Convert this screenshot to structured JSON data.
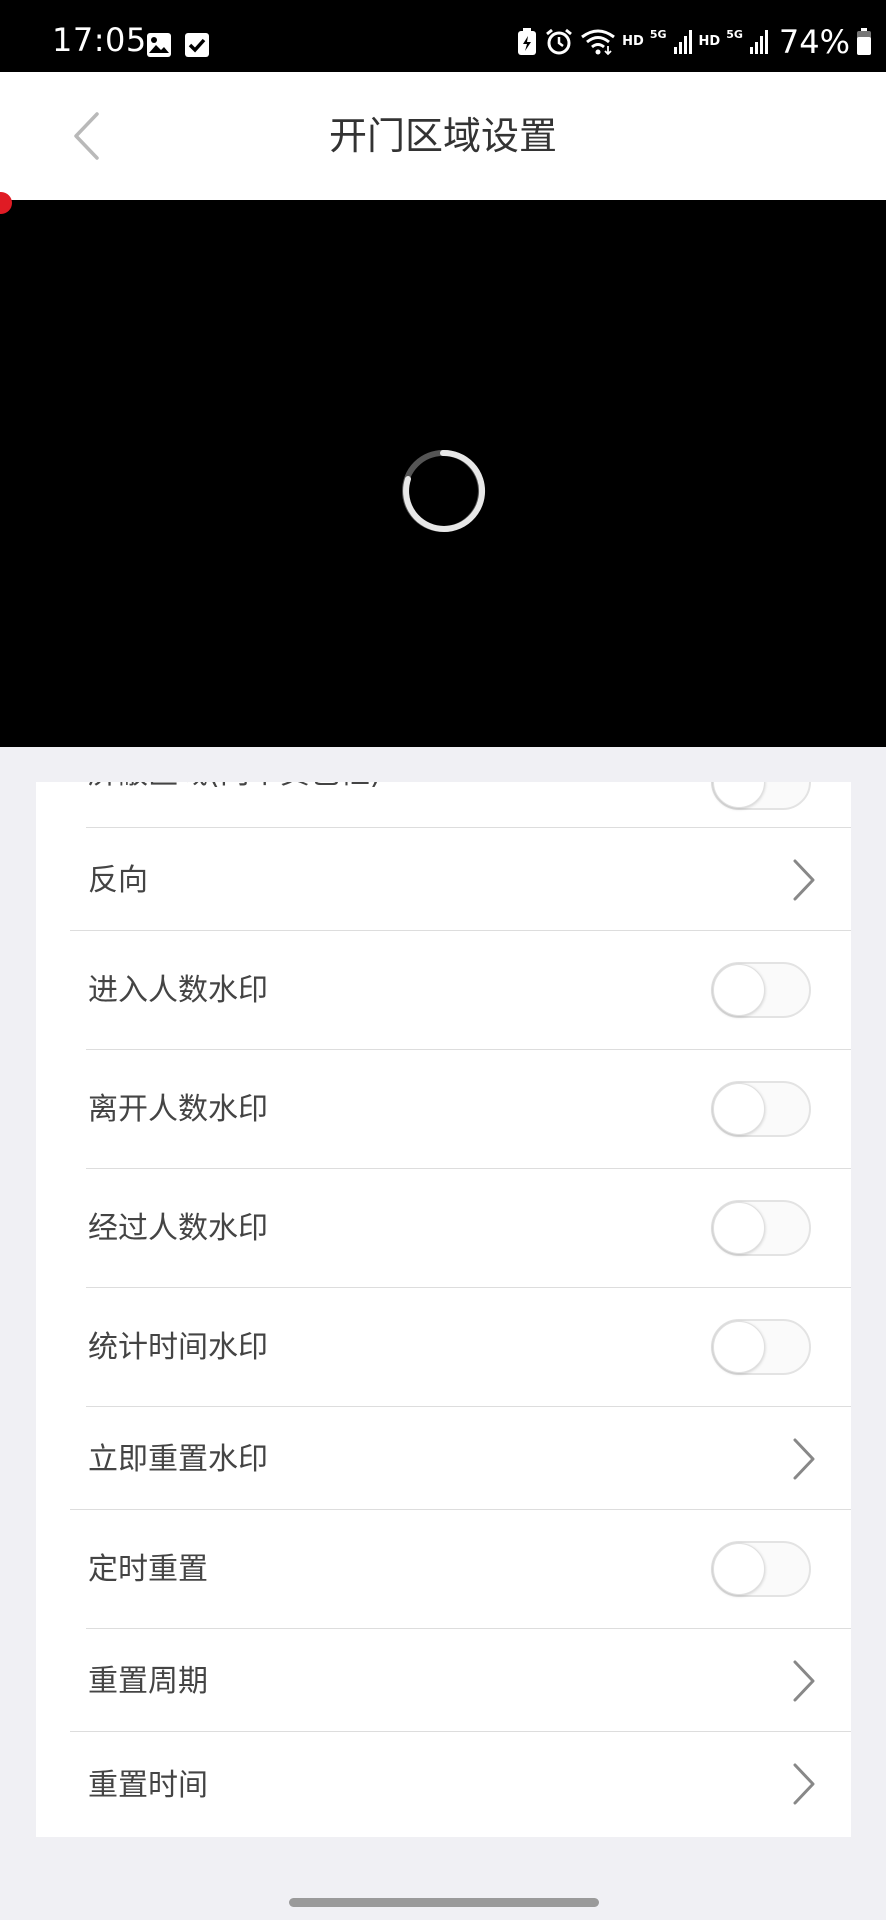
{
  "status_bar": {
    "time": "17:05",
    "network_hd_1": "HD",
    "network_5g_1": "5G",
    "network_hd_2": "HD",
    "network_5g_2": "5G",
    "battery": "74%"
  },
  "header": {
    "title": "开门区域设置",
    "back_icon": "chevron-left-icon"
  },
  "video": {
    "state": "loading",
    "spinner_icon": "loading-spinner-icon"
  },
  "settings": [
    {
      "id": "mask-area",
      "label": "屏蔽区域(两个黄色框)",
      "control": "toggle",
      "on": false
    },
    {
      "id": "reverse",
      "label": "反向",
      "control": "chevron"
    },
    {
      "id": "enter-count-watermark",
      "label": "进入人数水印",
      "control": "toggle",
      "on": false
    },
    {
      "id": "leave-count-watermark",
      "label": "离开人数水印",
      "control": "toggle",
      "on": false
    },
    {
      "id": "pass-count-watermark",
      "label": "经过人数水印",
      "control": "toggle",
      "on": false
    },
    {
      "id": "stats-time-watermark",
      "label": "统计时间水印",
      "control": "toggle",
      "on": false
    },
    {
      "id": "reset-watermark-now",
      "label": "立即重置水印",
      "control": "chevron"
    },
    {
      "id": "scheduled-reset",
      "label": "定时重置",
      "control": "toggle",
      "on": false
    },
    {
      "id": "reset-period",
      "label": "重置周期",
      "control": "chevron"
    },
    {
      "id": "reset-time",
      "label": "重置时间",
      "control": "chevron"
    }
  ],
  "colors": {
    "header_bg": "#ffffff",
    "page_bg": "#f0f0f4",
    "video_bg": "#000000",
    "text": "#444444",
    "divider": "#dddddd",
    "toggle_off_border": "#e3e3e3",
    "red_marker": "#e01b24"
  }
}
